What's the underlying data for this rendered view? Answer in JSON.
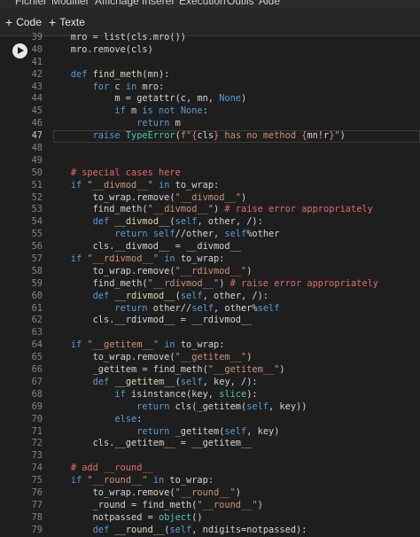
{
  "menu": [
    "Fichier",
    "Modifier",
    "Affichage",
    "Insérer",
    "Exécution",
    "Outils",
    "Aide"
  ],
  "toolbar": {
    "code_label": "Code",
    "text_label": "Texte"
  },
  "cell": {
    "current_line": 47,
    "lines": [
      {
        "n": 39,
        "segs": [
          {
            "t": "    mro = list(cls.mro())",
            "c": "txt"
          }
        ]
      },
      {
        "n": 40,
        "segs": [
          {
            "t": "    mro.remove(cls)",
            "c": "txt"
          }
        ]
      },
      {
        "n": 41,
        "segs": []
      },
      {
        "n": 42,
        "segs": [
          {
            "t": "    ",
            "c": "txt"
          },
          {
            "t": "def",
            "c": "kw"
          },
          {
            "t": " ",
            "c": "txt"
          },
          {
            "t": "find_meth",
            "c": "fn"
          },
          {
            "t": "(mn):",
            "c": "txt"
          }
        ]
      },
      {
        "n": 43,
        "segs": [
          {
            "t": "        ",
            "c": "txt"
          },
          {
            "t": "for",
            "c": "kw"
          },
          {
            "t": " c ",
            "c": "txt"
          },
          {
            "t": "in",
            "c": "kw"
          },
          {
            "t": " mro:",
            "c": "txt"
          }
        ]
      },
      {
        "n": 44,
        "segs": [
          {
            "t": "            m = getattr(c, mn, ",
            "c": "txt"
          },
          {
            "t": "None",
            "c": "kw"
          },
          {
            "t": ")",
            "c": "txt"
          }
        ]
      },
      {
        "n": 45,
        "segs": [
          {
            "t": "            ",
            "c": "txt"
          },
          {
            "t": "if",
            "c": "kw"
          },
          {
            "t": " m ",
            "c": "txt"
          },
          {
            "t": "is not",
            "c": "kw"
          },
          {
            "t": " ",
            "c": "txt"
          },
          {
            "t": "None",
            "c": "kw"
          },
          {
            "t": ":",
            "c": "txt"
          }
        ]
      },
      {
        "n": 46,
        "segs": [
          {
            "t": "                ",
            "c": "txt"
          },
          {
            "t": "return",
            "c": "kw"
          },
          {
            "t": " m",
            "c": "txt"
          }
        ]
      },
      {
        "n": 47,
        "segs": [
          {
            "t": "        ",
            "c": "txt"
          },
          {
            "t": "raise",
            "c": "kw"
          },
          {
            "t": " ",
            "c": "txt"
          },
          {
            "t": "TypeError",
            "c": "cls"
          },
          {
            "t": "(",
            "c": "txt"
          },
          {
            "t": "f\"{",
            "c": "str"
          },
          {
            "t": "cls",
            "c": "txt"
          },
          {
            "t": "} has no method {",
            "c": "str"
          },
          {
            "t": "mn!r",
            "c": "txt"
          },
          {
            "t": "}\"",
            "c": "str"
          },
          {
            "t": ")",
            "c": "txt"
          }
        ]
      },
      {
        "n": 48,
        "segs": []
      },
      {
        "n": 49,
        "segs": []
      },
      {
        "n": 50,
        "segs": [
          {
            "t": "    ",
            "c": "txt"
          },
          {
            "t": "# special cases here",
            "c": "cmt"
          }
        ]
      },
      {
        "n": 51,
        "segs": [
          {
            "t": "    ",
            "c": "txt"
          },
          {
            "t": "if",
            "c": "kw"
          },
          {
            "t": " ",
            "c": "txt"
          },
          {
            "t": "\"__divmod__\"",
            "c": "str"
          },
          {
            "t": " ",
            "c": "txt"
          },
          {
            "t": "in",
            "c": "kw"
          },
          {
            "t": " to_wrap:",
            "c": "txt"
          }
        ]
      },
      {
        "n": 52,
        "segs": [
          {
            "t": "        to_wrap.remove(",
            "c": "txt"
          },
          {
            "t": "\"__divmod__\"",
            "c": "str"
          },
          {
            "t": ")",
            "c": "txt"
          }
        ]
      },
      {
        "n": 53,
        "segs": [
          {
            "t": "        find_meth(",
            "c": "txt"
          },
          {
            "t": "\"__divmod__\"",
            "c": "str"
          },
          {
            "t": ") ",
            "c": "txt"
          },
          {
            "t": "# raise error appropriately",
            "c": "cmt"
          }
        ]
      },
      {
        "n": 54,
        "segs": [
          {
            "t": "        ",
            "c": "txt"
          },
          {
            "t": "def",
            "c": "kw"
          },
          {
            "t": " ",
            "c": "txt"
          },
          {
            "t": "__divmod__",
            "c": "fn"
          },
          {
            "t": "(",
            "c": "txt"
          },
          {
            "t": "self",
            "c": "kw"
          },
          {
            "t": ", other, /):",
            "c": "txt"
          }
        ]
      },
      {
        "n": 55,
        "segs": [
          {
            "t": "            ",
            "c": "txt"
          },
          {
            "t": "return",
            "c": "kw"
          },
          {
            "t": " ",
            "c": "txt"
          },
          {
            "t": "self",
            "c": "kw"
          },
          {
            "t": "//other, ",
            "c": "txt"
          },
          {
            "t": "self",
            "c": "kw"
          },
          {
            "t": "%other",
            "c": "txt"
          }
        ]
      },
      {
        "n": 56,
        "segs": [
          {
            "t": "        cls.__divmod__ = __divmod__",
            "c": "txt"
          }
        ]
      },
      {
        "n": 57,
        "segs": [
          {
            "t": "    ",
            "c": "txt"
          },
          {
            "t": "if",
            "c": "kw"
          },
          {
            "t": " ",
            "c": "txt"
          },
          {
            "t": "\"__rdivmod__\"",
            "c": "str"
          },
          {
            "t": " ",
            "c": "txt"
          },
          {
            "t": "in",
            "c": "kw"
          },
          {
            "t": " to_wrap:",
            "c": "txt"
          }
        ]
      },
      {
        "n": 58,
        "segs": [
          {
            "t": "        to_wrap.remove(",
            "c": "txt"
          },
          {
            "t": "\"__rdivmod__\"",
            "c": "str"
          },
          {
            "t": ")",
            "c": "txt"
          }
        ]
      },
      {
        "n": 59,
        "segs": [
          {
            "t": "        find_meth(",
            "c": "txt"
          },
          {
            "t": "\"__rdivmod__\"",
            "c": "str"
          },
          {
            "t": ") ",
            "c": "txt"
          },
          {
            "t": "# raise error appropriately",
            "c": "cmt"
          }
        ]
      },
      {
        "n": 60,
        "segs": [
          {
            "t": "        ",
            "c": "txt"
          },
          {
            "t": "def",
            "c": "kw"
          },
          {
            "t": " ",
            "c": "txt"
          },
          {
            "t": "__rdivmod__",
            "c": "fn"
          },
          {
            "t": "(",
            "c": "txt"
          },
          {
            "t": "self",
            "c": "kw"
          },
          {
            "t": ", other, /):",
            "c": "txt"
          }
        ]
      },
      {
        "n": 61,
        "segs": [
          {
            "t": "            ",
            "c": "txt"
          },
          {
            "t": "return",
            "c": "kw"
          },
          {
            "t": " other//",
            "c": "txt"
          },
          {
            "t": "self",
            "c": "kw"
          },
          {
            "t": ", other%",
            "c": "txt"
          },
          {
            "t": "self",
            "c": "kw"
          }
        ]
      },
      {
        "n": 62,
        "segs": [
          {
            "t": "        cls.__rdivmod__ = __rdivmod__",
            "c": "txt"
          }
        ]
      },
      {
        "n": 63,
        "segs": []
      },
      {
        "n": 64,
        "segs": [
          {
            "t": "    ",
            "c": "txt"
          },
          {
            "t": "if",
            "c": "kw"
          },
          {
            "t": " ",
            "c": "txt"
          },
          {
            "t": "\"__getitem__\"",
            "c": "str"
          },
          {
            "t": " ",
            "c": "txt"
          },
          {
            "t": "in",
            "c": "kw"
          },
          {
            "t": " to_wrap:",
            "c": "txt"
          }
        ]
      },
      {
        "n": 65,
        "segs": [
          {
            "t": "        to_wrap.remove(",
            "c": "txt"
          },
          {
            "t": "\"__getitem__\"",
            "c": "str"
          },
          {
            "t": ")",
            "c": "txt"
          }
        ]
      },
      {
        "n": 66,
        "segs": [
          {
            "t": "        _getitem = find_meth(",
            "c": "txt"
          },
          {
            "t": "\"__getitem__\"",
            "c": "str"
          },
          {
            "t": ")",
            "c": "txt"
          }
        ]
      },
      {
        "n": 67,
        "segs": [
          {
            "t": "        ",
            "c": "txt"
          },
          {
            "t": "def",
            "c": "kw"
          },
          {
            "t": " ",
            "c": "txt"
          },
          {
            "t": "__getitem__",
            "c": "fn"
          },
          {
            "t": "(",
            "c": "txt"
          },
          {
            "t": "self",
            "c": "kw"
          },
          {
            "t": ", key, /):",
            "c": "txt"
          }
        ]
      },
      {
        "n": 68,
        "segs": [
          {
            "t": "            ",
            "c": "txt"
          },
          {
            "t": "if",
            "c": "kw"
          },
          {
            "t": " isinstance(key, ",
            "c": "txt"
          },
          {
            "t": "slice",
            "c": "cls"
          },
          {
            "t": "):",
            "c": "txt"
          }
        ]
      },
      {
        "n": 69,
        "segs": [
          {
            "t": "                ",
            "c": "txt"
          },
          {
            "t": "return",
            "c": "kw"
          },
          {
            "t": " cls(_getitem(",
            "c": "txt"
          },
          {
            "t": "self",
            "c": "kw"
          },
          {
            "t": ", key))",
            "c": "txt"
          }
        ]
      },
      {
        "n": 70,
        "segs": [
          {
            "t": "            ",
            "c": "txt"
          },
          {
            "t": "else",
            "c": "kw"
          },
          {
            "t": ":",
            "c": "txt"
          }
        ]
      },
      {
        "n": 71,
        "segs": [
          {
            "t": "                ",
            "c": "txt"
          },
          {
            "t": "return",
            "c": "kw"
          },
          {
            "t": " _getitem(",
            "c": "txt"
          },
          {
            "t": "self",
            "c": "kw"
          },
          {
            "t": ", key)",
            "c": "txt"
          }
        ]
      },
      {
        "n": 72,
        "segs": [
          {
            "t": "        cls.__getitem__ = __getitem__",
            "c": "txt"
          }
        ]
      },
      {
        "n": 73,
        "segs": []
      },
      {
        "n": 74,
        "segs": [
          {
            "t": "    ",
            "c": "txt"
          },
          {
            "t": "# add __round__",
            "c": "cmt"
          }
        ]
      },
      {
        "n": 75,
        "segs": [
          {
            "t": "    ",
            "c": "txt"
          },
          {
            "t": "if",
            "c": "kw"
          },
          {
            "t": " ",
            "c": "txt"
          },
          {
            "t": "\"__round__\"",
            "c": "str"
          },
          {
            "t": " ",
            "c": "txt"
          },
          {
            "t": "in",
            "c": "kw"
          },
          {
            "t": " to_wrap:",
            "c": "txt"
          }
        ]
      },
      {
        "n": 76,
        "segs": [
          {
            "t": "        to_wrap.remove(",
            "c": "txt"
          },
          {
            "t": "\"__round__\"",
            "c": "str"
          },
          {
            "t": ")",
            "c": "txt"
          }
        ]
      },
      {
        "n": 77,
        "segs": [
          {
            "t": "        _round = find_meth(",
            "c": "txt"
          },
          {
            "t": "\"__round__\"",
            "c": "str"
          },
          {
            "t": ")",
            "c": "txt"
          }
        ]
      },
      {
        "n": 78,
        "segs": [
          {
            "t": "        notpassed = ",
            "c": "txt"
          },
          {
            "t": "object",
            "c": "cls"
          },
          {
            "t": "()",
            "c": "txt"
          }
        ]
      },
      {
        "n": 79,
        "segs": [
          {
            "t": "        ",
            "c": "txt"
          },
          {
            "t": "def",
            "c": "kw"
          },
          {
            "t": " ",
            "c": "txt"
          },
          {
            "t": "__round__",
            "c": "fn"
          },
          {
            "t": "(",
            "c": "txt"
          },
          {
            "t": "self",
            "c": "kw"
          },
          {
            "t": ", ndigits=notpassed):",
            "c": "txt"
          }
        ]
      }
    ]
  }
}
